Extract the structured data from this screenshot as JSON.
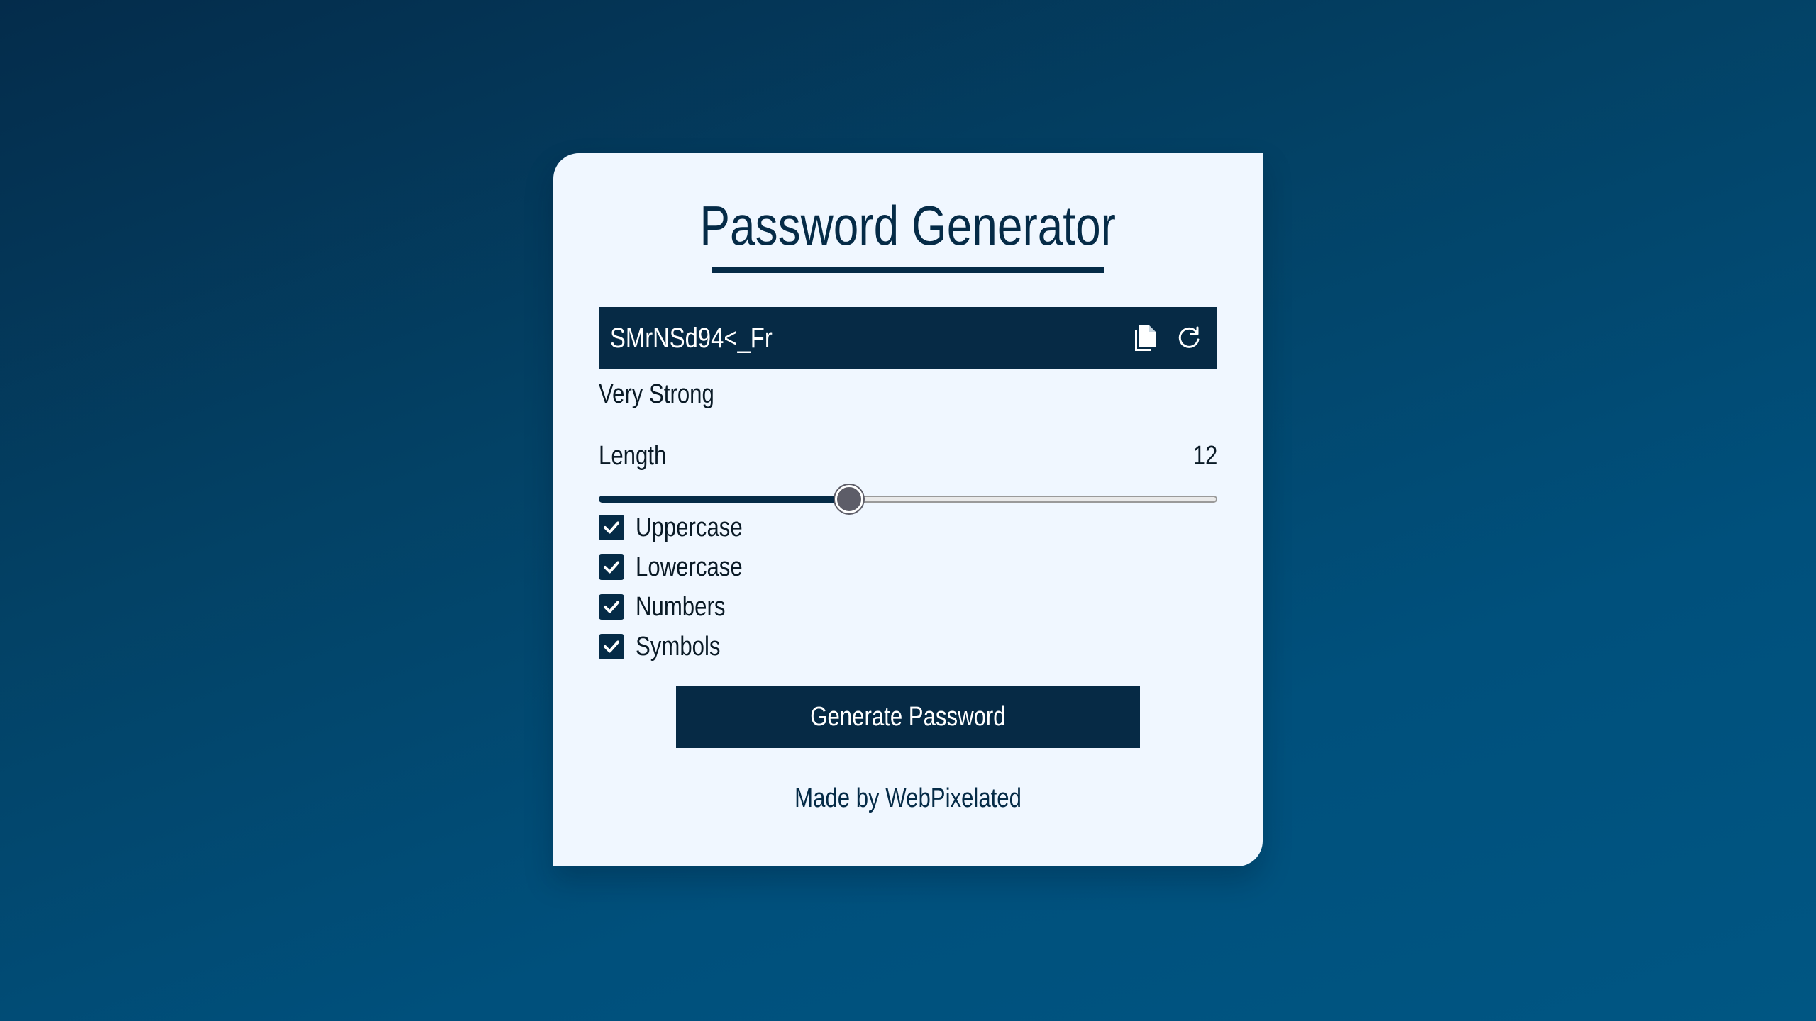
{
  "app": {
    "title": "Password Generator"
  },
  "password": {
    "value": "SMrNSd94<_Fr",
    "copy_icon": "copy-icon",
    "refresh_icon": "refresh-icon"
  },
  "strength": {
    "label": "Very Strong"
  },
  "length": {
    "label": "Length",
    "value": "12",
    "fill_fraction": 0.405
  },
  "options": [
    {
      "label": "Uppercase",
      "checked": true
    },
    {
      "label": "Lowercase",
      "checked": true
    },
    {
      "label": "Numbers",
      "checked": true
    },
    {
      "label": "Symbols",
      "checked": true
    }
  ],
  "generate_button": {
    "label": "Generate Password"
  },
  "footer": {
    "credit": "Made by WebPixelated"
  },
  "colors": {
    "primary": "#052b47",
    "card_background": "#f0f7ff",
    "page_gradient_start": "#042c4b",
    "page_gradient_end": "#005683",
    "slider_thumb": "#5d5d68"
  }
}
